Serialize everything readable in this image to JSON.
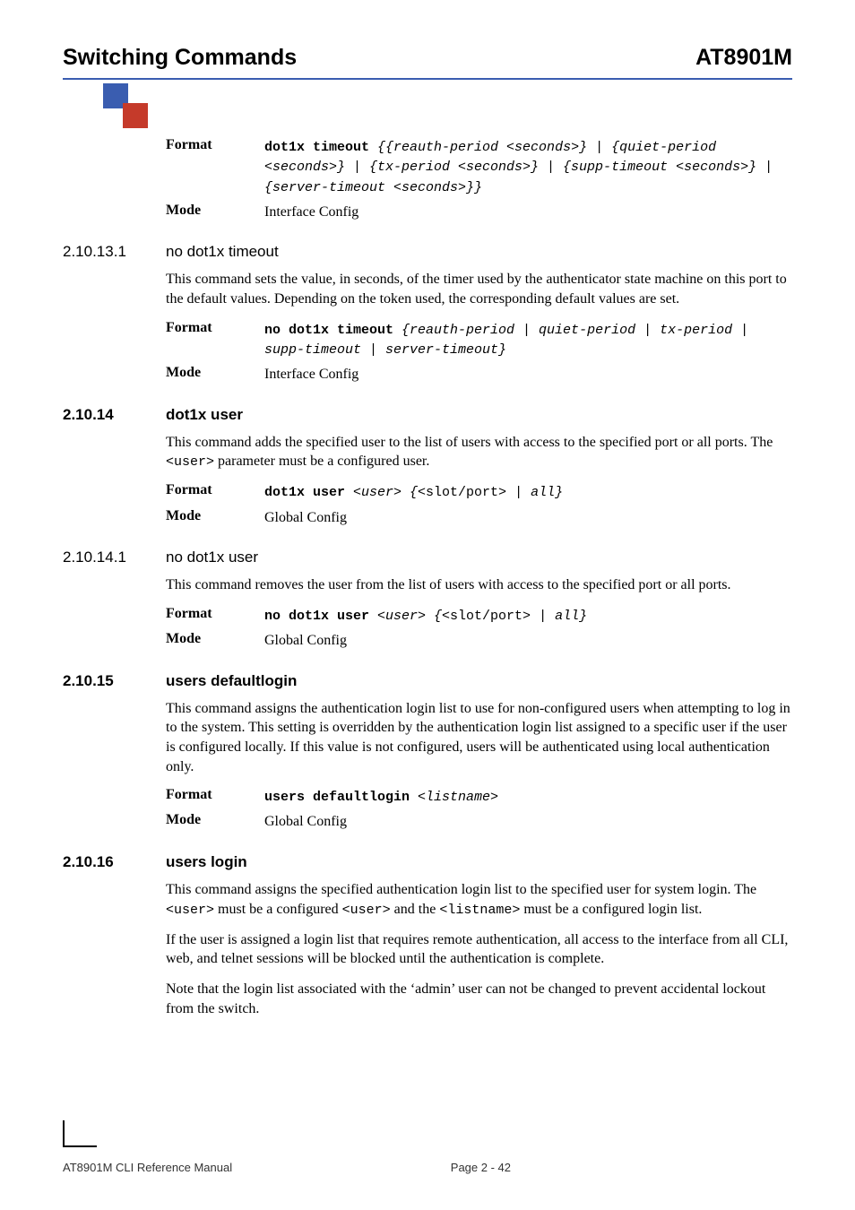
{
  "header": {
    "left": "Switching Commands",
    "right": "AT8901M"
  },
  "block1": {
    "format_label": "Format",
    "format_cmd": "dot1x timeout ",
    "format_args": "{{reauth-period <seconds>} | {quiet-period <seconds>} | {tx-period <seconds>} | {supp-timeout <seconds>} | {server-timeout <seconds>}}",
    "mode_label": "Mode",
    "mode_val": "Interface Config"
  },
  "s1": {
    "num": "2.10.13.1",
    "title": "no dot1x timeout",
    "body": "This command sets the value, in seconds, of the timer used by the authenticator state machine on this port to the default values. Depending on the token used, the corresponding default values are set.",
    "format_label": "Format",
    "format_cmd": "no dot1x timeout ",
    "format_args": "{reauth-period | quiet-period | tx-period | supp-timeout | server-timeout}",
    "mode_label": "Mode",
    "mode_val": "Interface Config"
  },
  "s2": {
    "num": "2.10.14",
    "title": "dot1x user",
    "body1": "This command adds the specified user to the list of users with access to the specified port or all ports. The ",
    "body_mono": "<user>",
    "body2": " parameter must be a configured user.",
    "format_label": "Format",
    "format_cmd": "dot1x user ",
    "format_arg1": "<user> {",
    "format_plain": "<slot/port>",
    "format_arg2": " | all}",
    "mode_label": "Mode",
    "mode_val": "Global Config"
  },
  "s3": {
    "num": "2.10.14.1",
    "title": "no dot1x user",
    "body": "This command removes the user from the list of users with access to the specified port or all ports.",
    "format_label": "Format",
    "format_cmd": "no dot1x user ",
    "format_arg1": "<user> {",
    "format_plain": "<slot/port>",
    "format_arg2": " | all}",
    "mode_label": "Mode",
    "mode_val": "Global Config"
  },
  "s4": {
    "num": "2.10.15",
    "title": "users defaultlogin",
    "body": "This command assigns the authentication login list to use for non-configured users when attempting to log in to the system. This setting is overridden by the authentication login list assigned to a specific user if the user is configured locally. If this value is not configured, users will be authenticated using local authentication only.",
    "format_label": "Format",
    "format_cmd": "users defaultlogin ",
    "format_args": "<listname>",
    "mode_label": "Mode",
    "mode_val": "Global Config"
  },
  "s5": {
    "num": "2.10.16",
    "title": "users login",
    "p1a": "This command assigns the specified authentication login list to the specified user for system login. The ",
    "m1": "<user>",
    "p1b": " must be a configured ",
    "m2": "<user>",
    "p1c": "  and the ",
    "m3": "<listname>",
    "p1d": "  must be a configured login list.",
    "p2": "If the user is assigned a login list that requires remote authentication, all access to the interface from all CLI, web, and telnet sessions will be blocked until the authentication is complete.",
    "p3": "Note that the login list associated with the ‘admin’ user can not be changed to prevent accidental lockout from the switch."
  },
  "footer": {
    "left": "AT8901M CLI Reference Manual",
    "right": "Page 2 - 42"
  }
}
